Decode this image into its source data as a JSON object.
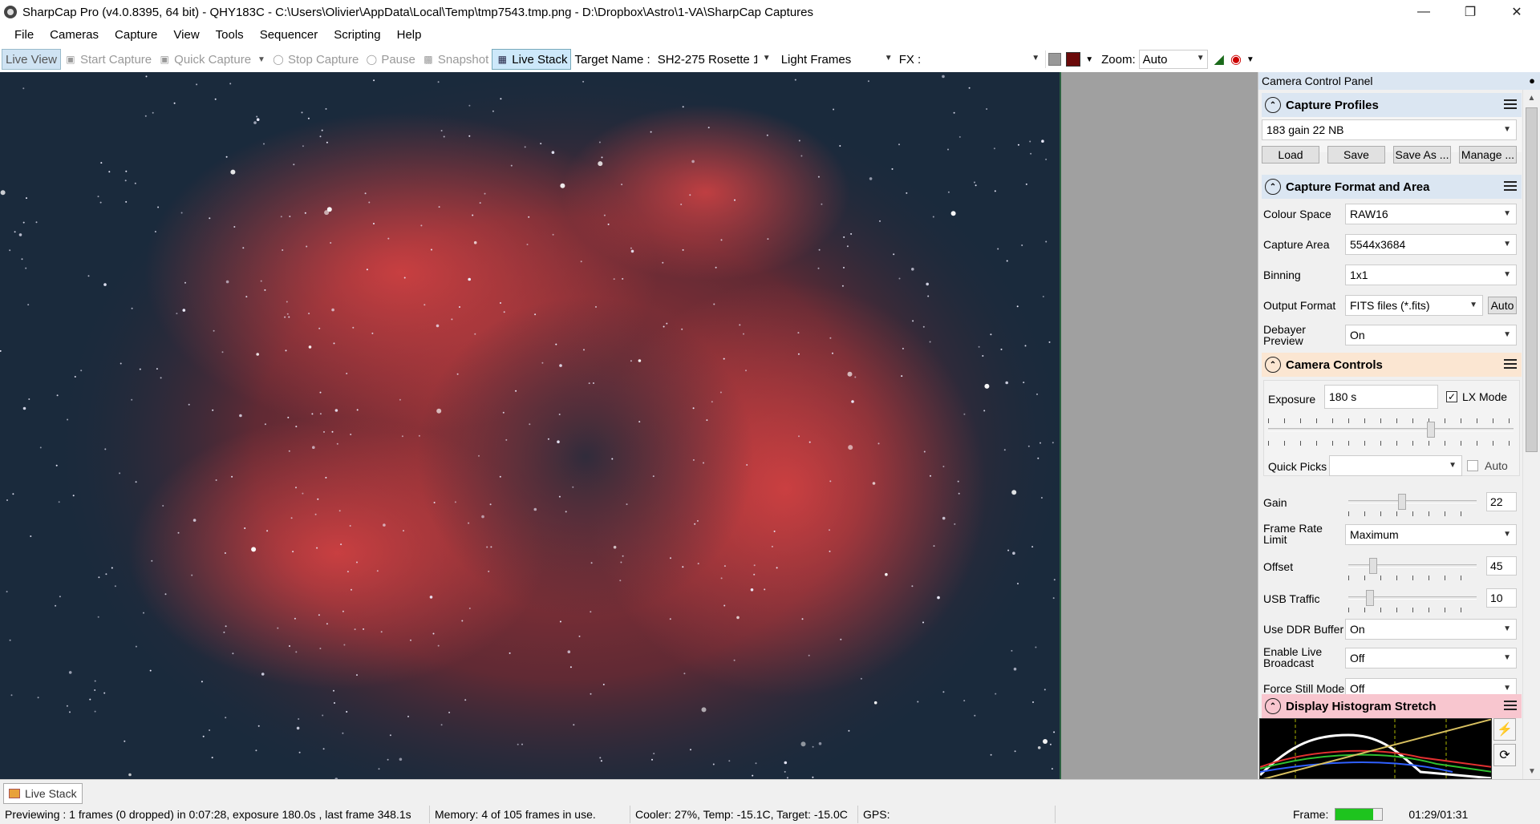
{
  "window": {
    "title": "SharpCap Pro (v4.0.8395, 64 bit) - QHY183C - C:\\Users\\Olivier\\AppData\\Local\\Temp\\tmp7543.tmp.png - D:\\Dropbox\\Astro\\1-VA\\SharpCap Captures"
  },
  "menu": [
    "File",
    "Cameras",
    "Capture",
    "View",
    "Tools",
    "Sequencer",
    "Scripting",
    "Help"
  ],
  "toolbar": {
    "live_view": "Live View",
    "start_capture": "Start Capture",
    "quick_capture": "Quick Capture",
    "stop_capture": "Stop Capture",
    "pause": "Pause",
    "snapshot": "Snapshot",
    "live_stack": "Live Stack",
    "target_name_label": "Target Name :",
    "target_name_value": "SH2-275 Rosette 1!",
    "frame_type": "Light Frames",
    "fx_label": "FX :",
    "fx_value": "",
    "zoom_label": "Zoom:",
    "zoom_value": "Auto"
  },
  "panel": {
    "title": "Camera Control Panel",
    "capture_profiles": {
      "title": "Capture Profiles",
      "selected": "183 gain 22 NB",
      "load": "Load",
      "save": "Save",
      "save_as": "Save As ...",
      "manage": "Manage ..."
    },
    "format": {
      "title": "Capture Format and Area",
      "colour_space_label": "Colour Space",
      "colour_space": "RAW16",
      "capture_area_label": "Capture Area",
      "capture_area": "5544x3684",
      "binning_label": "Binning",
      "binning": "1x1",
      "output_format_label": "Output Format",
      "output_format": "FITS files (*.fits)",
      "auto": "Auto",
      "debayer_label_1": "Debayer",
      "debayer_label_2": "Preview",
      "debayer": "On"
    },
    "controls": {
      "title": "Camera Controls",
      "exposure_label": "Exposure",
      "exposure": "180 s",
      "lx_mode": "LX Mode",
      "lx_checked": true,
      "quick_picks_label": "Quick Picks",
      "quick_picks": "",
      "auto": "Auto",
      "gain_label": "Gain",
      "gain": "22",
      "frame_rate_label_1": "Frame Rate",
      "frame_rate_label_2": "Limit",
      "frame_rate": "Maximum",
      "offset_label": "Offset",
      "offset": "45",
      "usb_label": "USB Traffic",
      "usb": "10",
      "ddr_label": "Use DDR Buffer",
      "ddr": "On",
      "broadcast_label_1": "Enable Live",
      "broadcast_label_2": "Broadcast",
      "broadcast": "Off",
      "still_label": "Force Still Mode",
      "still": "Off"
    },
    "histogram": {
      "title": "Display Histogram Stretch"
    }
  },
  "bottom_tab": "Live Stack",
  "status": {
    "previewing": "Previewing : 1 frames (0 dropped) in 0:07:28, exposure 180.0s , last frame 348.1s",
    "memory": "Memory: 4 of 105 frames in use.",
    "cooler": "Cooler: 27%, Temp: -15.1C, Target: -15.0C",
    "gps": "GPS:",
    "frame_label": "Frame:",
    "frame_progress": 0.8,
    "time": "01:29/01:31"
  },
  "colors": {
    "accent": "#cde8fa",
    "camera_controls_header": "#fbe6d2",
    "histogram_header": "#f8c6cf",
    "section_header": "#dbe6f2"
  }
}
